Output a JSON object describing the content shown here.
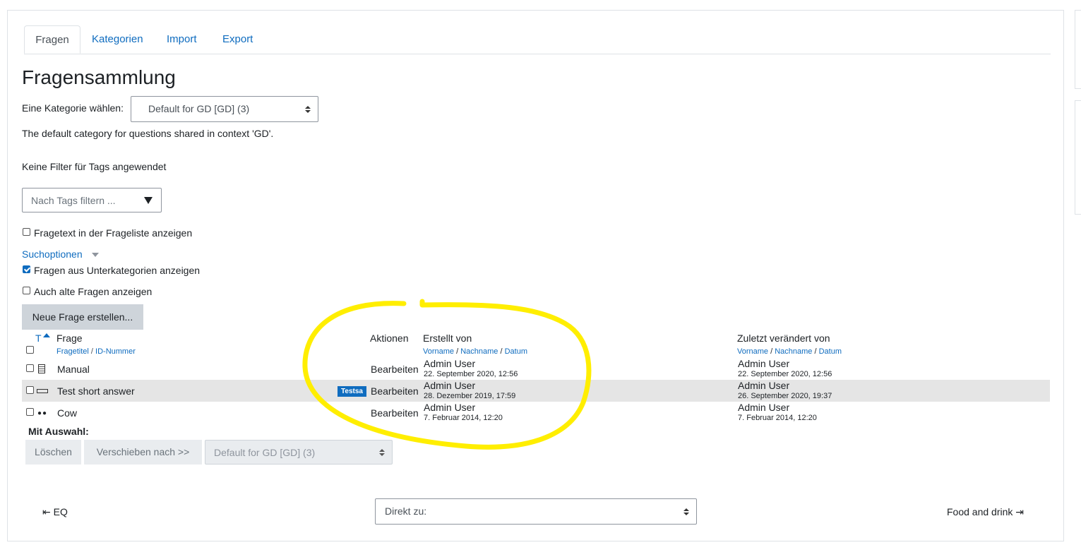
{
  "tabs": [
    {
      "label": "Fragen",
      "active": true
    },
    {
      "label": "Kategorien"
    },
    {
      "label": "Import"
    },
    {
      "label": "Export"
    }
  ],
  "page_title": "Fragensammlung",
  "category": {
    "label": "Eine Kategorie wählen:",
    "selected": "Default for GD [GD] (3)",
    "description": "The default category for questions shared in context 'GD'."
  },
  "tags": {
    "status": "Keine Filter für Tags angewendet",
    "placeholder": "Nach Tags filtern ..."
  },
  "options": {
    "show_text_label": "Fragetext in der Frageliste anzeigen",
    "show_text_checked": false,
    "search_options_label": "Suchoptionen",
    "subcats_label": "Fragen aus Unterkategorien anzeigen",
    "subcats_checked": true,
    "old_label": "Auch alte Fragen anzeigen",
    "old_checked": false
  },
  "new_question_button": "Neue Frage erstellen...",
  "table": {
    "col_type": "T",
    "col_question": "Frage",
    "col_question_sub": {
      "a": "Fragetitel",
      "sep": " / ",
      "b": "ID-Nummer"
    },
    "col_actions": "Aktionen",
    "col_created": "Erstellt von",
    "col_modified": "Zuletzt verändert von",
    "sub_sort": {
      "first": "Vorname",
      "sep1": " / ",
      "last": "Nachname",
      "sep2": " / ",
      "date": "Datum"
    },
    "rows": [
      {
        "name": "Manual",
        "type_icon": "manual-grading-icon",
        "badge": "",
        "action": "Bearbeiten",
        "created_by": "Admin User",
        "created_at": "22. September 2020, 12:56",
        "modified_by": "Admin User",
        "modified_at": "22. September 2020, 12:56"
      },
      {
        "name": "Test short answer",
        "type_icon": "short-answer-icon",
        "badge": "Testsa",
        "action": "Bearbeiten",
        "created_by": "Admin User",
        "created_at": "28. Dezember 2019, 17:59",
        "modified_by": "Admin User",
        "modified_at": "26. September 2020, 19:37"
      },
      {
        "name": "Cow",
        "type_icon": "multichoice-dots-icon",
        "badge": "",
        "action": "Bearbeiten",
        "created_by": "Admin User",
        "created_at": "7. Februar 2014, 12:20",
        "modified_by": "Admin User",
        "modified_at": "7. Februar 2014, 12:20"
      }
    ]
  },
  "bulk": {
    "label": "Mit Auswahl:",
    "delete": "Löschen",
    "move": "Verschieben nach >>",
    "move_target": "Default for GD [GD] (3)"
  },
  "footer": {
    "prev": "EQ",
    "jump_placeholder": "Direkt zu:",
    "next": "Food and drink"
  },
  "colors": {
    "link": "#0f6cbf",
    "highlight_annotation": "#ffee00",
    "row_highlight": "#e5e5e5"
  }
}
